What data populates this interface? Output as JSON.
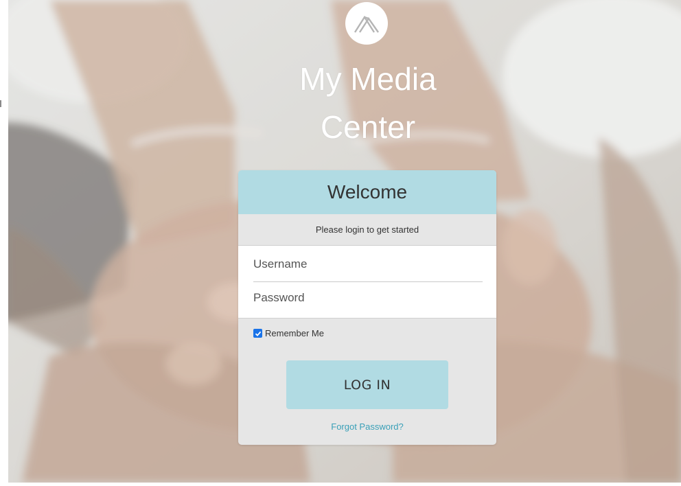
{
  "app": {
    "title_line1": "My Media",
    "title_line2": "Center",
    "logo_icon": "mountain-logo-icon"
  },
  "login": {
    "header": "Welcome",
    "subtitle": "Please login to get started",
    "username_placeholder": "Username",
    "password_placeholder": "Password",
    "remember_label": "Remember Me",
    "remember_checked": true,
    "login_button": "LOG IN",
    "forgot_link": "Forgot Password?"
  },
  "colors": {
    "accent": "#b1dbe3",
    "link": "#3aa0b8",
    "card_bg": "#e6e6e6",
    "checkbox": "#1a73e8"
  }
}
